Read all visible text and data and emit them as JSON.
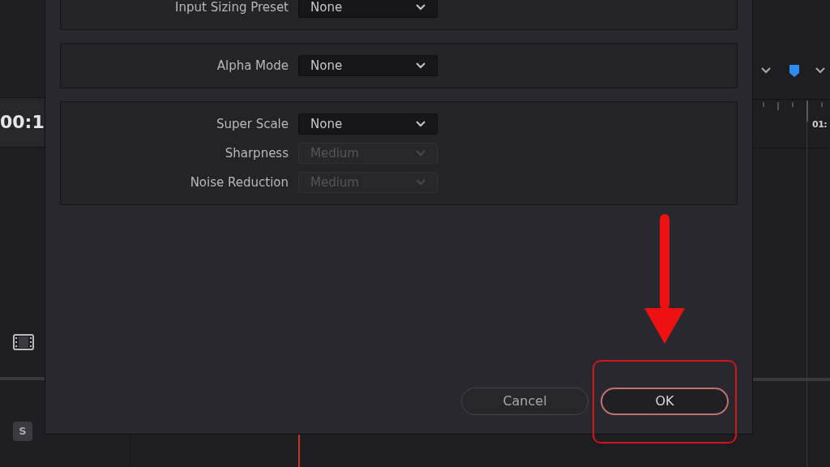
{
  "background_app": {
    "timecode": "00:1",
    "ruler_label": "01:",
    "solo_button": "S"
  },
  "dialog": {
    "sections": [
      {
        "rows": [
          {
            "label": "Input Sizing Preset",
            "value": "None",
            "disabled": false
          }
        ]
      },
      {
        "rows": [
          {
            "label": "Alpha Mode",
            "value": "None",
            "disabled": false
          }
        ]
      },
      {
        "rows": [
          {
            "label": "Super Scale",
            "value": "None",
            "disabled": false
          },
          {
            "label": "Sharpness",
            "value": "Medium",
            "disabled": true
          },
          {
            "label": "Noise Reduction",
            "value": "Medium",
            "disabled": true
          }
        ]
      }
    ],
    "buttons": [
      {
        "label": "Cancel",
        "kind": "secondary"
      },
      {
        "label": "OK",
        "kind": "primary"
      }
    ]
  }
}
